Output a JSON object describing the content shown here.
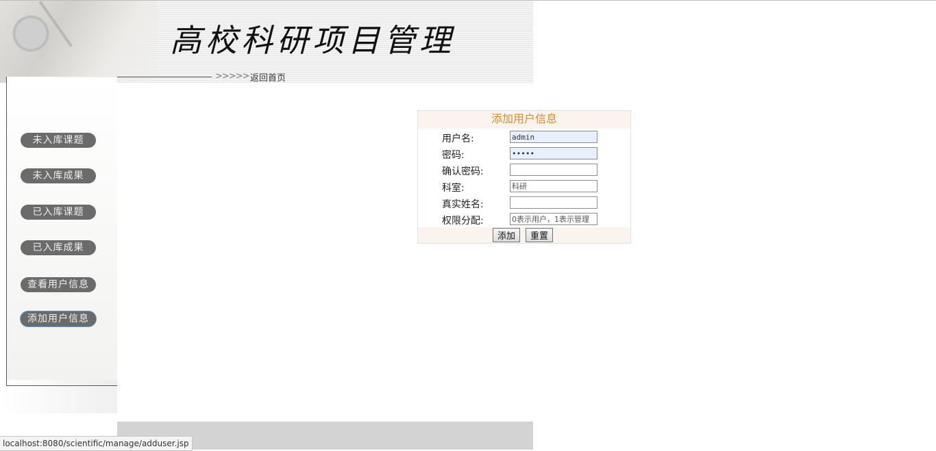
{
  "header": {
    "title": "高校科研项目管理",
    "chevrons": ">>>>>",
    "home_link": "返回首页"
  },
  "sidebar": {
    "items": [
      {
        "label": "未入库课题"
      },
      {
        "label": "未入库成果"
      },
      {
        "label": "已入库课题"
      },
      {
        "label": "已入库成果"
      },
      {
        "label": "查看用户信息"
      },
      {
        "label": "添加用户信息",
        "active": true
      }
    ]
  },
  "form": {
    "title": "添加用户信息",
    "fields": {
      "username": {
        "label": "用户名:",
        "value": "admin"
      },
      "password": {
        "label": "密码:",
        "value": "admin"
      },
      "confirm_password": {
        "label": "确认密码:",
        "value": ""
      },
      "department": {
        "label": "科室:",
        "placeholder": "科研"
      },
      "real_name": {
        "label": "真实姓名:",
        "value": ""
      },
      "permission": {
        "label": "权限分配:",
        "placeholder": "0表示用户，1表示管理"
      }
    },
    "submit_label": "添加",
    "reset_label": "重置"
  },
  "status_bar": {
    "url": "localhost:8080/scientific/manage/adduser.jsp"
  },
  "colors": {
    "form_title": "#d98a2b",
    "sidebar_button": "#6b6b6b",
    "footer_bar": "#d3d3d3"
  }
}
